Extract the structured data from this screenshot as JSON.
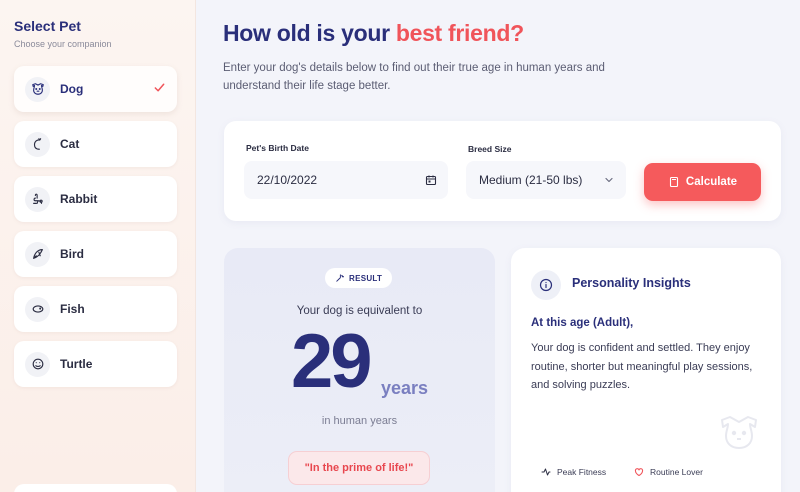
{
  "sidebar": {
    "title": "Select Pet",
    "subtitle": "Choose your companion",
    "pets": [
      {
        "label": "Dog",
        "icon": "dog-icon",
        "selected": true
      },
      {
        "label": "Cat",
        "icon": "cat-icon"
      },
      {
        "label": "Rabbit",
        "icon": "rabbit-icon"
      },
      {
        "label": "Bird",
        "icon": "bird-icon"
      },
      {
        "label": "Fish",
        "icon": "fish-icon"
      },
      {
        "label": "Turtle",
        "icon": "turtle-icon"
      }
    ]
  },
  "header": {
    "title_prefix": "How old is your",
    "title_accent": "best friend?",
    "description": "Enter your dog's details below to find out their true age in human years and understand their life stage better."
  },
  "form": {
    "birth_date_label": "Pet's Birth Date",
    "birth_date_value": "22/10/2022",
    "breed_size_label": "Breed Size",
    "breed_size_value": "Medium (21-50 lbs)",
    "calculate_label": "Calculate"
  },
  "result": {
    "badge": "RESULT",
    "equivalent_text": "Your dog is equivalent to",
    "age": "29",
    "unit": "years",
    "suffix": "in human years",
    "quote": "\"In the prime of life!\""
  },
  "insights": {
    "title": "Personality Insights",
    "stage": "At this age (Adult),",
    "body": "Your dog is confident and settled. They enjoy routine, shorter but meaningful play sessions, and solving puzzles.",
    "traits": [
      "Peak Fitness",
      "Routine Lover"
    ]
  },
  "colors": {
    "primary": "#2a2f7a",
    "accent": "#f0545a",
    "button": "#f55a5c"
  }
}
